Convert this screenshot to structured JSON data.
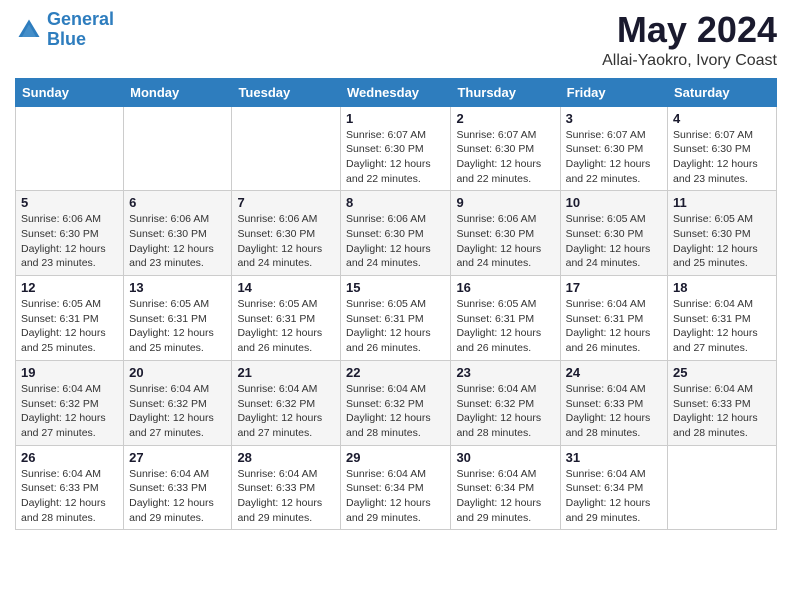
{
  "logo": {
    "line1": "General",
    "line2": "Blue"
  },
  "title": "May 2024",
  "subtitle": "Allai-Yaokro, Ivory Coast",
  "weekdays": [
    "Sunday",
    "Monday",
    "Tuesday",
    "Wednesday",
    "Thursday",
    "Friday",
    "Saturday"
  ],
  "weeks": [
    [
      {
        "day": "",
        "sunrise": "",
        "sunset": "",
        "daylight": ""
      },
      {
        "day": "",
        "sunrise": "",
        "sunset": "",
        "daylight": ""
      },
      {
        "day": "",
        "sunrise": "",
        "sunset": "",
        "daylight": ""
      },
      {
        "day": "1",
        "sunrise": "Sunrise: 6:07 AM",
        "sunset": "Sunset: 6:30 PM",
        "daylight": "Daylight: 12 hours and 22 minutes."
      },
      {
        "day": "2",
        "sunrise": "Sunrise: 6:07 AM",
        "sunset": "Sunset: 6:30 PM",
        "daylight": "Daylight: 12 hours and 22 minutes."
      },
      {
        "day": "3",
        "sunrise": "Sunrise: 6:07 AM",
        "sunset": "Sunset: 6:30 PM",
        "daylight": "Daylight: 12 hours and 22 minutes."
      },
      {
        "day": "4",
        "sunrise": "Sunrise: 6:07 AM",
        "sunset": "Sunset: 6:30 PM",
        "daylight": "Daylight: 12 hours and 23 minutes."
      }
    ],
    [
      {
        "day": "5",
        "sunrise": "Sunrise: 6:06 AM",
        "sunset": "Sunset: 6:30 PM",
        "daylight": "Daylight: 12 hours and 23 minutes."
      },
      {
        "day": "6",
        "sunrise": "Sunrise: 6:06 AM",
        "sunset": "Sunset: 6:30 PM",
        "daylight": "Daylight: 12 hours and 23 minutes."
      },
      {
        "day": "7",
        "sunrise": "Sunrise: 6:06 AM",
        "sunset": "Sunset: 6:30 PM",
        "daylight": "Daylight: 12 hours and 24 minutes."
      },
      {
        "day": "8",
        "sunrise": "Sunrise: 6:06 AM",
        "sunset": "Sunset: 6:30 PM",
        "daylight": "Daylight: 12 hours and 24 minutes."
      },
      {
        "day": "9",
        "sunrise": "Sunrise: 6:06 AM",
        "sunset": "Sunset: 6:30 PM",
        "daylight": "Daylight: 12 hours and 24 minutes."
      },
      {
        "day": "10",
        "sunrise": "Sunrise: 6:05 AM",
        "sunset": "Sunset: 6:30 PM",
        "daylight": "Daylight: 12 hours and 24 minutes."
      },
      {
        "day": "11",
        "sunrise": "Sunrise: 6:05 AM",
        "sunset": "Sunset: 6:30 PM",
        "daylight": "Daylight: 12 hours and 25 minutes."
      }
    ],
    [
      {
        "day": "12",
        "sunrise": "Sunrise: 6:05 AM",
        "sunset": "Sunset: 6:31 PM",
        "daylight": "Daylight: 12 hours and 25 minutes."
      },
      {
        "day": "13",
        "sunrise": "Sunrise: 6:05 AM",
        "sunset": "Sunset: 6:31 PM",
        "daylight": "Daylight: 12 hours and 25 minutes."
      },
      {
        "day": "14",
        "sunrise": "Sunrise: 6:05 AM",
        "sunset": "Sunset: 6:31 PM",
        "daylight": "Daylight: 12 hours and 26 minutes."
      },
      {
        "day": "15",
        "sunrise": "Sunrise: 6:05 AM",
        "sunset": "Sunset: 6:31 PM",
        "daylight": "Daylight: 12 hours and 26 minutes."
      },
      {
        "day": "16",
        "sunrise": "Sunrise: 6:05 AM",
        "sunset": "Sunset: 6:31 PM",
        "daylight": "Daylight: 12 hours and 26 minutes."
      },
      {
        "day": "17",
        "sunrise": "Sunrise: 6:04 AM",
        "sunset": "Sunset: 6:31 PM",
        "daylight": "Daylight: 12 hours and 26 minutes."
      },
      {
        "day": "18",
        "sunrise": "Sunrise: 6:04 AM",
        "sunset": "Sunset: 6:31 PM",
        "daylight": "Daylight: 12 hours and 27 minutes."
      }
    ],
    [
      {
        "day": "19",
        "sunrise": "Sunrise: 6:04 AM",
        "sunset": "Sunset: 6:32 PM",
        "daylight": "Daylight: 12 hours and 27 minutes."
      },
      {
        "day": "20",
        "sunrise": "Sunrise: 6:04 AM",
        "sunset": "Sunset: 6:32 PM",
        "daylight": "Daylight: 12 hours and 27 minutes."
      },
      {
        "day": "21",
        "sunrise": "Sunrise: 6:04 AM",
        "sunset": "Sunset: 6:32 PM",
        "daylight": "Daylight: 12 hours and 27 minutes."
      },
      {
        "day": "22",
        "sunrise": "Sunrise: 6:04 AM",
        "sunset": "Sunset: 6:32 PM",
        "daylight": "Daylight: 12 hours and 28 minutes."
      },
      {
        "day": "23",
        "sunrise": "Sunrise: 6:04 AM",
        "sunset": "Sunset: 6:32 PM",
        "daylight": "Daylight: 12 hours and 28 minutes."
      },
      {
        "day": "24",
        "sunrise": "Sunrise: 6:04 AM",
        "sunset": "Sunset: 6:33 PM",
        "daylight": "Daylight: 12 hours and 28 minutes."
      },
      {
        "day": "25",
        "sunrise": "Sunrise: 6:04 AM",
        "sunset": "Sunset: 6:33 PM",
        "daylight": "Daylight: 12 hours and 28 minutes."
      }
    ],
    [
      {
        "day": "26",
        "sunrise": "Sunrise: 6:04 AM",
        "sunset": "Sunset: 6:33 PM",
        "daylight": "Daylight: 12 hours and 28 minutes."
      },
      {
        "day": "27",
        "sunrise": "Sunrise: 6:04 AM",
        "sunset": "Sunset: 6:33 PM",
        "daylight": "Daylight: 12 hours and 29 minutes."
      },
      {
        "day": "28",
        "sunrise": "Sunrise: 6:04 AM",
        "sunset": "Sunset: 6:33 PM",
        "daylight": "Daylight: 12 hours and 29 minutes."
      },
      {
        "day": "29",
        "sunrise": "Sunrise: 6:04 AM",
        "sunset": "Sunset: 6:34 PM",
        "daylight": "Daylight: 12 hours and 29 minutes."
      },
      {
        "day": "30",
        "sunrise": "Sunrise: 6:04 AM",
        "sunset": "Sunset: 6:34 PM",
        "daylight": "Daylight: 12 hours and 29 minutes."
      },
      {
        "day": "31",
        "sunrise": "Sunrise: 6:04 AM",
        "sunset": "Sunset: 6:34 PM",
        "daylight": "Daylight: 12 hours and 29 minutes."
      },
      {
        "day": "",
        "sunrise": "",
        "sunset": "",
        "daylight": ""
      }
    ]
  ]
}
